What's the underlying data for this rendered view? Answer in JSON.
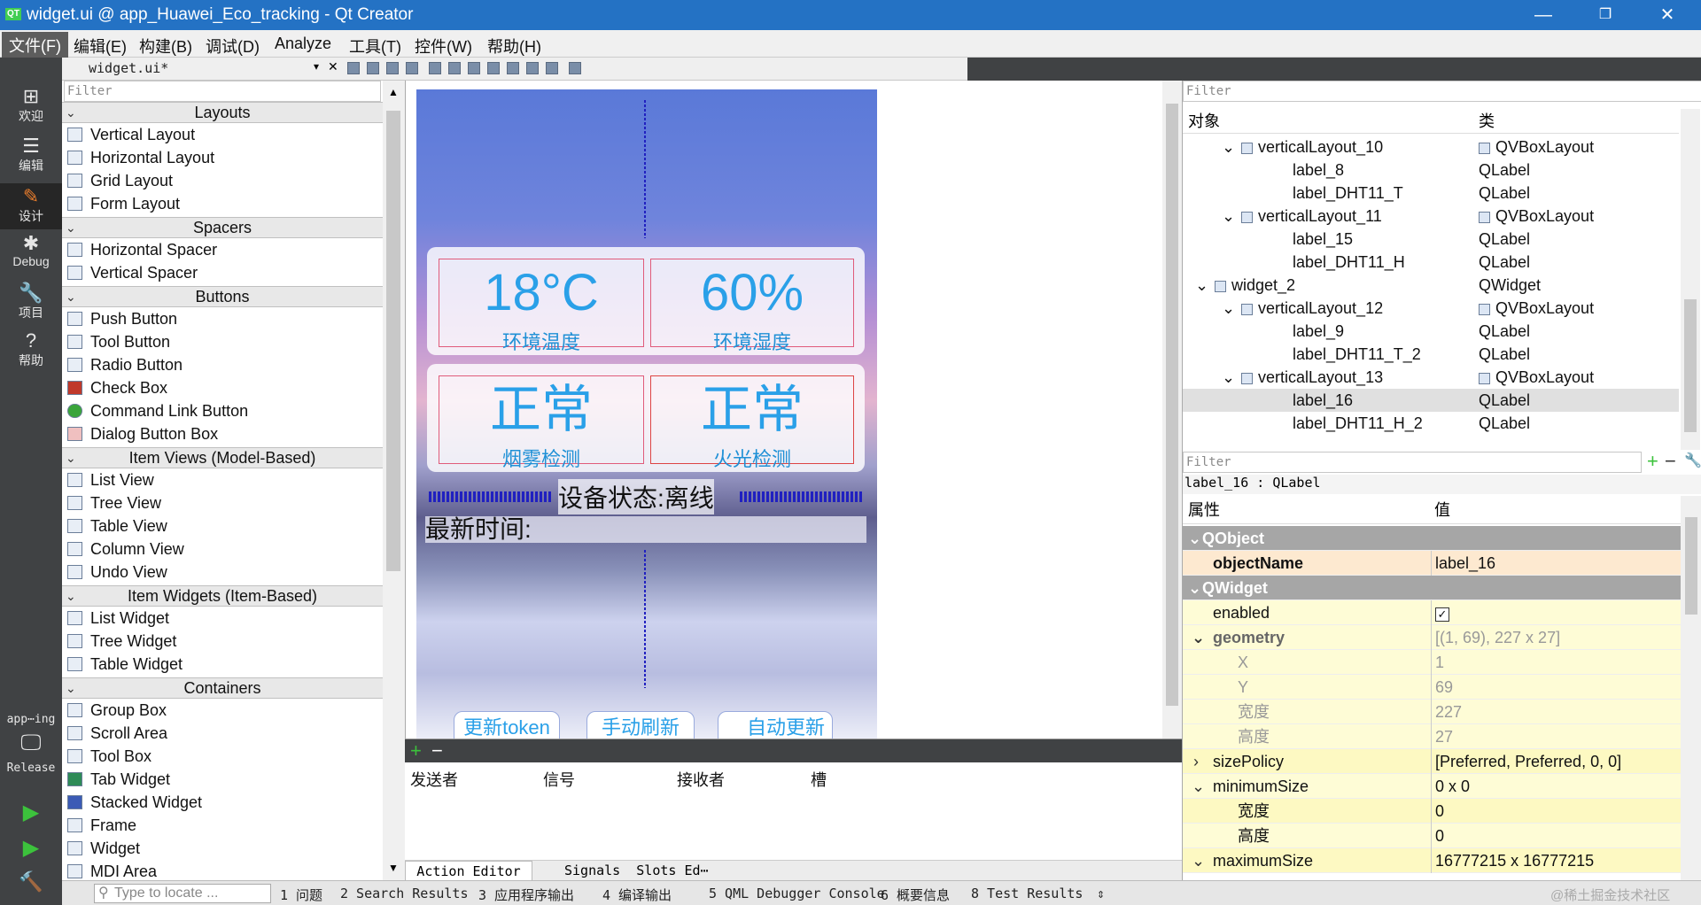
{
  "window": {
    "title": "widget.ui @ app_Huawei_Eco_tracking - Qt Creator",
    "logo": "QT"
  },
  "menu": [
    "文件(F)",
    "编辑(E)",
    "构建(B)",
    "调试(D)",
    "Analyze",
    "工具(T)",
    "控件(W)",
    "帮助(H)"
  ],
  "modes": [
    {
      "icon": "⊞",
      "label": "欢迎"
    },
    {
      "icon": "☰",
      "label": "编辑"
    },
    {
      "icon": "✎",
      "label": "设计"
    },
    {
      "icon": "✱",
      "label": "Debug"
    },
    {
      "icon": "🔧",
      "label": "项目"
    },
    {
      "icon": "?",
      "label": "帮助"
    }
  ],
  "kit": {
    "project": "app⋯ing",
    "build": "Release"
  },
  "editor": {
    "file": "widget.ui*"
  },
  "widgetbox": {
    "filter": "Filter",
    "categories": {
      "layouts": "Layouts",
      "spacers": "Spacers",
      "buttons": "Buttons",
      "itemviews": "Item Views (Model-Based)",
      "itemwidgets": "Item Widgets (Item-Based)",
      "containers": "Containers"
    },
    "items": {
      "l1": "Vertical Layout",
      "l2": "Horizontal Layout",
      "l3": "Grid Layout",
      "l4": "Form Layout",
      "s1": "Horizontal Spacer",
      "s2": "Vertical Spacer",
      "b1": "Push Button",
      "b2": "Tool Button",
      "b3": "Radio Button",
      "b4": "Check Box",
      "b5": "Command Link Button",
      "b6": "Dialog Button Box",
      "v1": "List View",
      "v2": "Tree View",
      "v3": "Table View",
      "v4": "Column View",
      "v5": "Undo View",
      "w1": "List Widget",
      "w2": "Tree Widget",
      "w3": "Table Widget",
      "c1": "Group Box",
      "c2": "Scroll Area",
      "c3": "Tool Box",
      "c4": "Tab Widget",
      "c5": "Stacked Widget",
      "c6": "Frame",
      "c7": "Widget",
      "c8": "MDI Area"
    }
  },
  "form": {
    "temp": {
      "value": "18°C",
      "label": "环境温度"
    },
    "hum": {
      "value": "60%",
      "label": "环境湿度"
    },
    "smoke": {
      "value": "正常",
      "label": "烟雾检测"
    },
    "fire": {
      "value": "正常",
      "label": "火光检测"
    },
    "status": "设备状态:离线",
    "latest": "最新时间:",
    "btn_token": "更新token",
    "btn_refresh": "手动刷新",
    "btn_auto": "自动更新"
  },
  "action_editor": {
    "columns": [
      "发送者",
      "信号",
      "接收者",
      "槽"
    ],
    "tabs": [
      "Action Editor",
      "Signals  Slots Ed⋯"
    ]
  },
  "object_inspector": {
    "filter": "Filter",
    "headers": [
      "对象",
      "类"
    ],
    "rows": [
      {
        "o": "verticalLayout_10",
        "c": "QVBoxLayout"
      },
      {
        "o": "label_8",
        "c": "QLabel"
      },
      {
        "o": "label_DHT11_T",
        "c": "QLabel"
      },
      {
        "o": "verticalLayout_11",
        "c": "QVBoxLayout"
      },
      {
        "o": "label_15",
        "c": "QLabel"
      },
      {
        "o": "label_DHT11_H",
        "c": "QLabel"
      },
      {
        "o": "widget_2",
        "c": "QWidget"
      },
      {
        "o": "verticalLayout_12",
        "c": "QVBoxLayout"
      },
      {
        "o": "label_9",
        "c": "QLabel"
      },
      {
        "o": "label_DHT11_T_2",
        "c": "QLabel"
      },
      {
        "o": "verticalLayout_13",
        "c": "QVBoxLayout"
      },
      {
        "o": "label_16",
        "c": "QLabel"
      },
      {
        "o": "label_DHT11_H_2",
        "c": "QLabel"
      }
    ]
  },
  "property_editor": {
    "filter": "Filter",
    "selected": "label_16 : QLabel",
    "headers": [
      "属性",
      "值"
    ],
    "rows": [
      {
        "n": "QObject",
        "v": ""
      },
      {
        "n": "objectName",
        "v": "label_16"
      },
      {
        "n": "QWidget",
        "v": ""
      },
      {
        "n": "enabled",
        "v": "✓"
      },
      {
        "n": "geometry",
        "v": "[(1, 69), 227 x 27]"
      },
      {
        "n": "X",
        "v": "1"
      },
      {
        "n": "Y",
        "v": "69"
      },
      {
        "n": "宽度",
        "v": "227"
      },
      {
        "n": "高度",
        "v": "27"
      },
      {
        "n": "sizePolicy",
        "v": "[Preferred, Preferred, 0, 0]"
      },
      {
        "n": "minimumSize",
        "v": "0 x 0"
      },
      {
        "n": "宽度",
        "v": "0"
      },
      {
        "n": "高度",
        "v": "0"
      },
      {
        "n": "maximumSize",
        "v": "16777215 x 16777215"
      }
    ]
  },
  "statusbar": {
    "locate": "Type to locate ...",
    "panes": [
      "1 问题",
      "2 Search Results",
      "3 应用程序输出",
      "4 编译输出",
      "5 QML Debugger Console",
      "6 概要信息",
      "8 Test Results"
    ],
    "watermark": "@稀土掘金技术社区"
  }
}
